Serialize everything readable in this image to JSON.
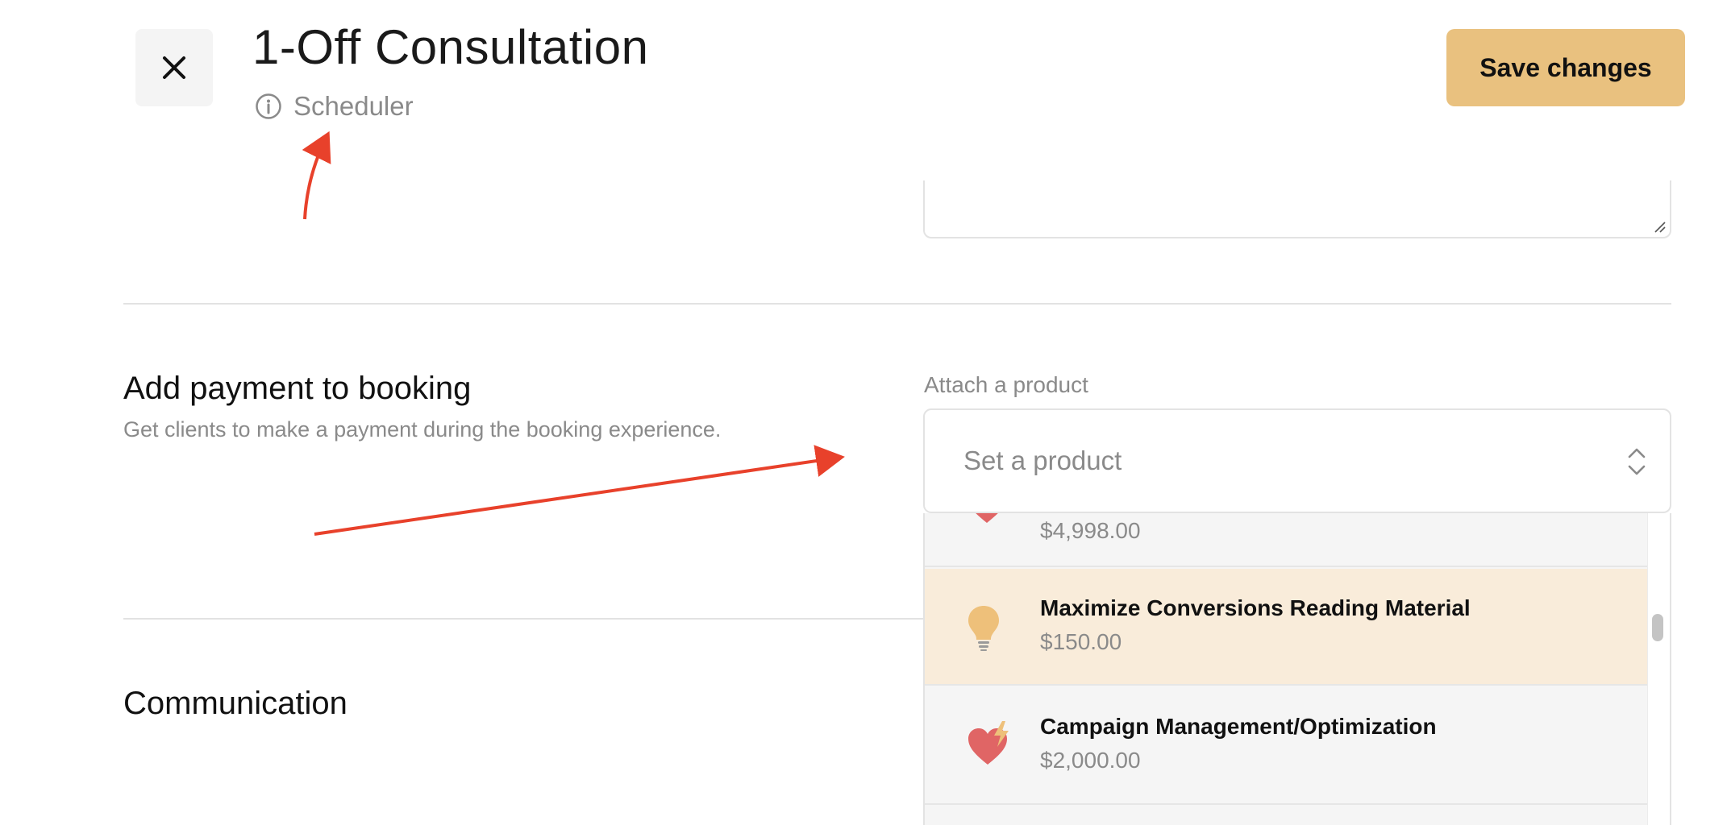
{
  "header": {
    "title": "1-Off Consultation",
    "subtitle": "Scheduler",
    "save_label": "Save changes"
  },
  "payment_section": {
    "title": "Add payment to booking",
    "description": "Get clients to make a payment during the booking experience.",
    "field_label": "Attach a product",
    "select_placeholder": "Set a product"
  },
  "product_list": [
    {
      "name": "",
      "price": "$4,998.00",
      "icon": "heart-icon"
    },
    {
      "name": "Maximize Conversions Reading Material",
      "price": "$150.00",
      "icon": "lightbulb-icon",
      "highlighted": true
    },
    {
      "name": "Campaign Management/Optimization",
      "price": "$2,000.00",
      "icon": "heart-lightning-icon"
    }
  ],
  "communication_section": {
    "title": "Communication"
  },
  "colors": {
    "accent": "#e9c17f",
    "highlight": "#f9ecda",
    "annotation_arrow": "#e8412b",
    "heart": "#e06565",
    "bulb": "#eec07a"
  }
}
